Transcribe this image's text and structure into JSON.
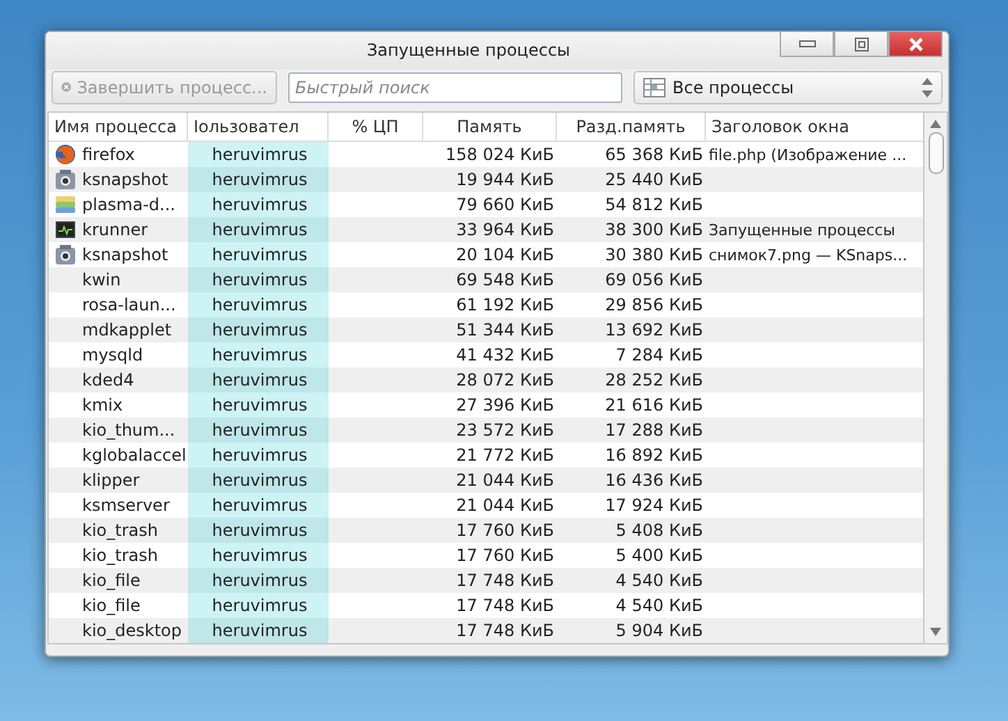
{
  "window": {
    "title": "Запущенные процессы"
  },
  "toolbar": {
    "end_button": {
      "label": "Завершить процесс...",
      "disabled": true
    },
    "search": {
      "placeholder": "Быстрый поиск"
    },
    "filter": {
      "value": "Все процессы"
    }
  },
  "table": {
    "columns": [
      "Имя процесса",
      "Іользовател",
      "% ЦП",
      "Память",
      "Разд.память",
      "Заголовок окна"
    ],
    "rows": [
      {
        "kind": "browser",
        "name": "firefox",
        "user": "heruvimrus",
        "memory": "158 024 КиБ",
        "shared": "65 368 КиБ",
        "title": "file.php (Изображение ..."
      },
      {
        "kind": "camera",
        "name": "ksnapshot",
        "user": "heruvimrus",
        "memory": "19 944 КиБ",
        "shared": "25 440 КиБ"
      },
      {
        "kind": "stack",
        "name": "plasma-d...",
        "user": "heruvimrus",
        "memory": "79 660 КиБ",
        "shared": "54 812 КиБ"
      },
      {
        "kind": "monitor",
        "name": "krunner",
        "user": "heruvimrus",
        "memory": "33 964 КиБ",
        "shared": "38 300 КиБ",
        "title": "Запущенные процессы"
      },
      {
        "kind": "camera",
        "name": "ksnapshot",
        "user": "heruvimrus",
        "memory": "20 104 КиБ",
        "shared": "30 380 КиБ",
        "title": "снимок7.png — KSnaps..."
      },
      {
        "kind": "none",
        "name": "kwin",
        "user": "heruvimrus",
        "memory": "69 548 КиБ",
        "shared": "69 056 КиБ"
      },
      {
        "kind": "none",
        "name": "rosa-laun...",
        "user": "heruvimrus",
        "memory": "61 192 КиБ",
        "shared": "29 856 КиБ"
      },
      {
        "kind": "none",
        "name": "mdkapplet",
        "user": "heruvimrus",
        "memory": "51 344 КиБ",
        "shared": "13 692 КиБ"
      },
      {
        "kind": "none",
        "name": "mysqld",
        "user": "heruvimrus",
        "memory": "41 432 КиБ",
        "shared": "7 284 КиБ"
      },
      {
        "kind": "none",
        "name": "kded4",
        "user": "heruvimrus",
        "memory": "28 072 КиБ",
        "shared": "28 252 КиБ"
      },
      {
        "kind": "none",
        "name": "kmix",
        "user": "heruvimrus",
        "memory": "27 396 КиБ",
        "shared": "21 616 КиБ"
      },
      {
        "kind": "none",
        "name": "kio_thum...",
        "user": "heruvimrus",
        "memory": "23 572 КиБ",
        "shared": "17 288 КиБ"
      },
      {
        "kind": "none",
        "name": "kglobalaccel",
        "user": "heruvimrus",
        "memory": "21 772 КиБ",
        "shared": "16 892 КиБ"
      },
      {
        "kind": "none",
        "name": "klipper",
        "user": "heruvimrus",
        "memory": "21 044 КиБ",
        "shared": "16 436 КиБ"
      },
      {
        "kind": "none",
        "name": "ksmserver",
        "user": "heruvimrus",
        "memory": "21 044 КиБ",
        "shared": "17 924 КиБ"
      },
      {
        "kind": "none",
        "name": "kio_trash",
        "user": "heruvimrus",
        "memory": "17 760 КиБ",
        "shared": "5 408 КиБ"
      },
      {
        "kind": "none",
        "name": "kio_trash",
        "user": "heruvimrus",
        "memory": "17 760 КиБ",
        "shared": "5 400 КиБ"
      },
      {
        "kind": "none",
        "name": "kio_file",
        "user": "heruvimrus",
        "memory": "17 748 КиБ",
        "shared": "4 540 КиБ"
      },
      {
        "kind": "none",
        "name": "kio_file",
        "user": "heruvimrus",
        "memory": "17 748 КиБ",
        "shared": "4 540 КиБ"
      },
      {
        "kind": "none",
        "name": "kio_desktop",
        "user": "heruvimrus",
        "memory": "17 748 КиБ",
        "shared": "5 904 КиБ"
      }
    ]
  }
}
